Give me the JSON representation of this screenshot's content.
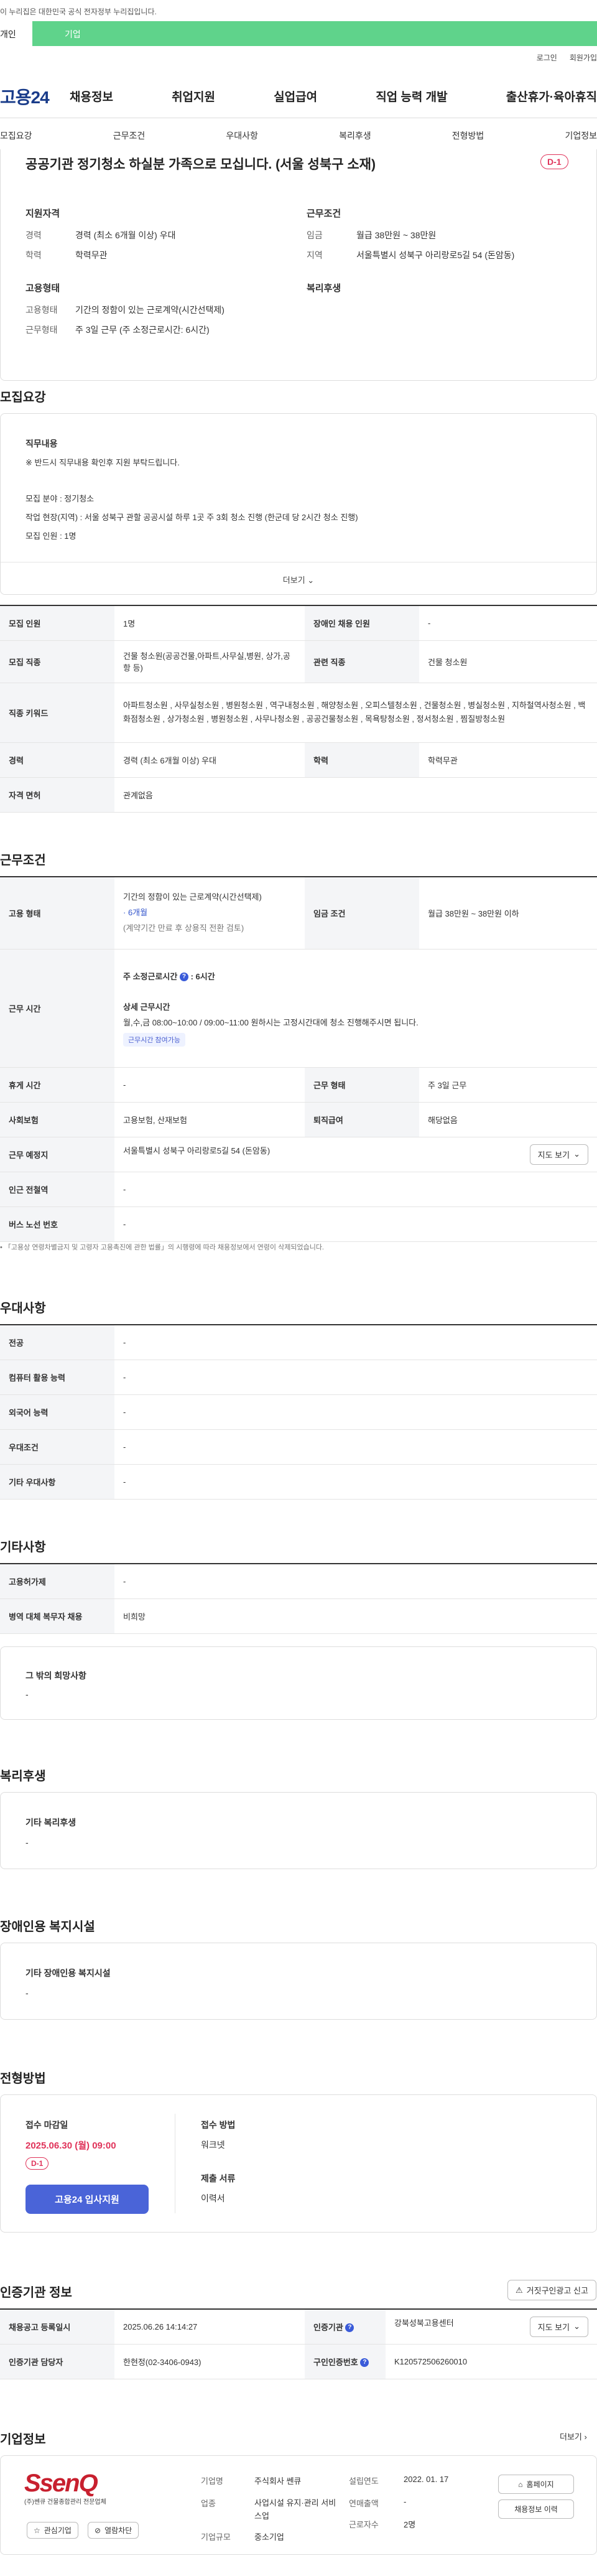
{
  "notice": "이 누리집은 대한민국 공식 전자정부 누리집입니다.",
  "gov_tabs": [
    "개인",
    "기업"
  ],
  "util": [
    "로그인",
    "회원가입"
  ],
  "logo": "고용24",
  "gnb": [
    "채용정보",
    "취업지원",
    "실업급여",
    "직업 능력 개발",
    "출산휴가·육아휴직"
  ],
  "lnb": [
    "모집요강",
    "근무조건",
    "우대사항",
    "복리후생",
    "전형방법",
    "기업정보"
  ],
  "header": {
    "title": "공공기관 정기청소 하실분 가족으로 모십니다. (서울 성북구 소재)",
    "dday": "D-1",
    "qual_title": "지원자격",
    "career_label": "경력",
    "career_val": "경력 (최소 6개월 이상) 우대",
    "edu_label": "학력",
    "edu_val": "학력무관",
    "cond_title": "근무조건",
    "wage_label": "임금",
    "wage_val": "월급 38만원 ~ 38만원",
    "region_label": "지역",
    "region_val": "서울특별시 성북구 아리랑로5길 54 (돈암동)",
    "emp_title": "고용형태",
    "emp_type_label": "고용형태",
    "emp_type_val": "기간의 정함이 있는 근로계약(시간선택제)",
    "work_type_label": "근무형태",
    "work_type_val": "주 3일 근무 (주 소정근로시간: 6시간)",
    "welfare_title": "복리후생"
  },
  "recruit": {
    "title": "모집요강",
    "duty_title": "직무내용",
    "lines": [
      "※ 반드시 직무내용 확인후 지원 부탁드립니다.",
      "",
      "모집 분야 : 정기청소",
      "작업 현장(지역) : 서울 성북구 관할 공공시설 하루 1곳 주 3회 청소 진행 (한군데 당 2시간 청소 진행)",
      "모집 인원 : 1명"
    ],
    "more": "더보기"
  },
  "recruit_table": {
    "rows": [
      [
        "모집 인원",
        "1명",
        "장애인 채용 인원",
        "-"
      ],
      [
        "모집 직종",
        "건물 청소원(공공건물,아파트,사무실,병원, 상가,공항 등)",
        "관련 직종",
        "건물 청소원"
      ],
      [
        "직종 키워드",
        "아파트청소원 , 사무실청소원 , 병원청소원 , 역구내청소원 , 해양청소원 , 오피스텔청소원 , 건물청소원 , 병실청소원 , 지하철역사청소원 , 백화점청소원 , 상가청소원 , 병원청소원 , 사무나청소원 , 공공건물청소원 , 목욕탕청소원 , 정서청소원 , 찜질방청소원"
      ],
      [
        "경력",
        "경력 (최소 6개월 이상) 우대",
        "학력",
        "학력무관"
      ],
      [
        "자격 면허",
        "관계없음"
      ]
    ]
  },
  "work": {
    "title": "근무조건",
    "emp_label": "고용 형태",
    "emp_lines": [
      "기간의 정함이 있는 근로계약(시간선택제)",
      "· 6개월",
      "(계약기간 만료 후 상용직 전환 검토)"
    ],
    "wage_label": "임금 조건",
    "wage_val": "월급 38만원 ~ 38만원 이하",
    "time_label": "근무 시간",
    "time_weekly": "주 소정근로시간",
    "time_weekly_val": "6시간",
    "time_detail_title": "상세 근무시간",
    "time_detail": "월,수,금 08:00~10:00 / 09:00~11:00 원하시는 고정시간대에 청소 진행해주시면 됩니다.",
    "time_tag": "근무시간 참여가능",
    "rest_label": "휴게 시간",
    "rest_val": "-",
    "form_label": "근무 형태",
    "form_val": "주 3일 근무",
    "ins_label": "사회보험",
    "ins_val": "고용보험, 산재보험",
    "sev_label": "퇴직급여",
    "sev_val": "해당없음",
    "place_label": "근무 예정지",
    "place_val": "서울특별시 성북구 아리랑로5길 54 (돈암동)",
    "map_btn": "지도 보기",
    "subway_label": "인근 전철역",
    "subway_val": "-",
    "bus_label": "버스 노선 번호",
    "bus_val": "-",
    "footnote": "「고용상 연령차별금지 및 고령자 고용촉진에 관한 법률」의 시행령에 따라 채용정보에서 연령이 삭제되었습니다."
  },
  "pref": {
    "title": "우대사항",
    "rows": [
      [
        "전공",
        "-"
      ],
      [
        "컴퓨터 활용 능력",
        "-"
      ],
      [
        "외국어 능력",
        "-"
      ],
      [
        "우대조건",
        "-"
      ],
      [
        "기타 우대사항",
        "-"
      ]
    ]
  },
  "etc": {
    "title": "기타사항",
    "rows": [
      [
        "고용허가제",
        "-"
      ],
      [
        "병역 대체 복무자 채용",
        "비희망"
      ]
    ],
    "other_title": "그 밖의 희망사항",
    "other_val": "-"
  },
  "welfare": {
    "title": "복리후생",
    "box_title": "기타 복리후생",
    "box_val": "-"
  },
  "disab": {
    "title": "장애인용 복지시설",
    "box_title": "기타 장애인용 복지시설",
    "box_val": "-"
  },
  "process": {
    "title": "전형방법",
    "deadline_label": "접수 마감일",
    "deadline_val": "2025.06.30 (월) 09:00",
    "dday": "D-1",
    "apply_btn": "고용24 입사지원",
    "method_label": "접수 방법",
    "method_val": "워크넷",
    "docs_label": "제출 서류",
    "docs_val": "이력서"
  },
  "cert": {
    "title": "인증기관 정보",
    "report_btn": "거짓구인광고 신고",
    "rows": [
      [
        "채용공고 등록일시",
        "2025.06.26 14:14:27",
        "인증기관",
        "강북성북고용센터"
      ],
      [
        "인증기관 담당자",
        "한현정(02-3406-0943)",
        "구인인증번호",
        "K120572506260010"
      ]
    ],
    "map_btn": "지도 보기"
  },
  "company": {
    "title": "기업정보",
    "more": "더보기",
    "logo_text": "SsenQ",
    "logo_sub": "(주)쎈큐 건물종합관리 전문업체",
    "fav_btn": "관심기업",
    "block_btn": "열람차단",
    "fields": [
      [
        "기업명",
        "주식회사 쎈큐"
      ],
      [
        "업종",
        "사업시설 유지·관리 서비스업"
      ],
      [
        "기업규모",
        "중소기업"
      ]
    ],
    "fields2": [
      [
        "설립연도",
        "2022. 01. 17"
      ],
      [
        "연매출액",
        "-"
      ],
      [
        "근로자수",
        "2명"
      ]
    ],
    "home_btn": "홈페이지",
    "hist_btn": "채용정보 이력"
  },
  "colors": {
    "accent": "#4a64d8",
    "dday": "#e0335a",
    "gov_green": "#5fd38b"
  }
}
